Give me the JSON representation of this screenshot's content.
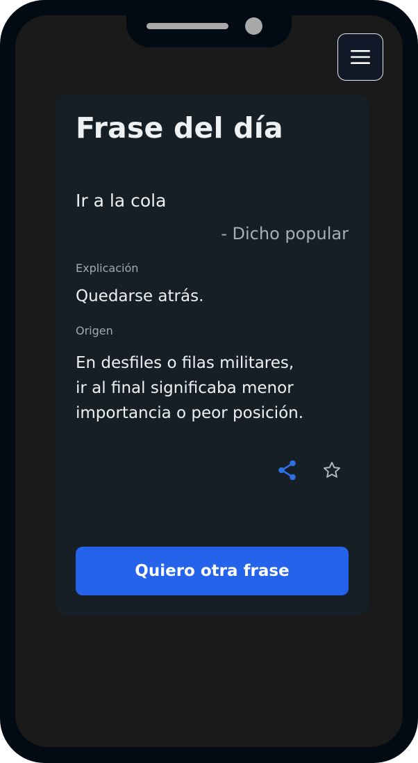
{
  "menu": {
    "icon": "hamburger-menu-icon"
  },
  "card": {
    "title": "Frase del día",
    "phrase": "Ir a la cola",
    "author": "- Dicho popular",
    "explanation_label": "Explicación",
    "explanation": "Quedarse atrás.",
    "origin_label": "Origen",
    "origin_lines": [
      "En desfiles o filas militares,",
      "ir al final significaba menor",
      "importancia o peor posición."
    ]
  },
  "actions": {
    "share_icon": "share-icon",
    "favorite_icon": "star-icon"
  },
  "button": {
    "label": "Quiero otra frase"
  },
  "colors": {
    "accent": "#2563eb",
    "card_background": "#161f25",
    "screen_background": "#1a1a1a"
  }
}
